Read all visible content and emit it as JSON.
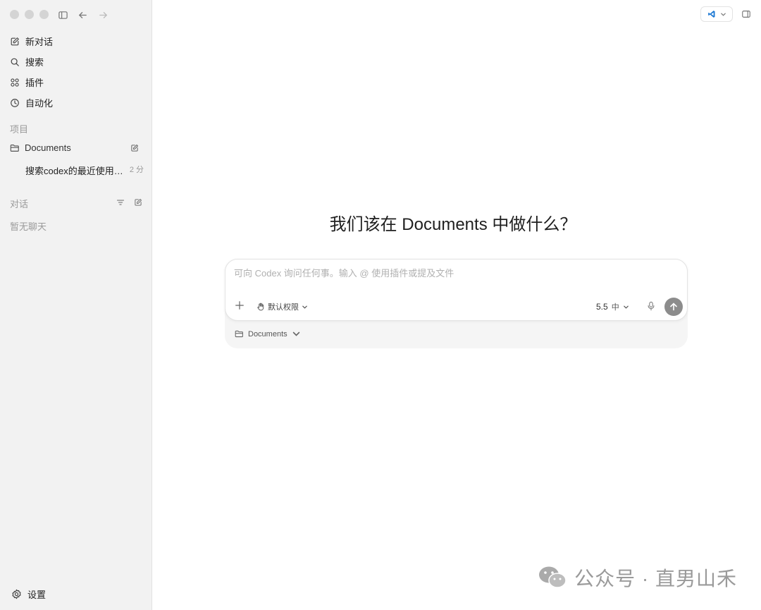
{
  "sidebar": {
    "nav": [
      {
        "label": "新对话",
        "icon": "edit-icon"
      },
      {
        "label": "搜索",
        "icon": "search-icon"
      },
      {
        "label": "插件",
        "icon": "plugins-icon"
      },
      {
        "label": "自动化",
        "icon": "clock-icon"
      }
    ],
    "projects_label": "项目",
    "project_name": "Documents",
    "thread_title": "搜索codex的最近使用…",
    "thread_time": "2 分",
    "chats_label": "对话",
    "empty_chats": "暂无聊天",
    "settings_label": "设置"
  },
  "main": {
    "heading": "我们该在 Documents 中做什么？",
    "composer": {
      "placeholder": "可向 Codex 询问任何事。输入 @ 使用插件或提及文件",
      "permission_label": "默认权限",
      "model_version": "5.5",
      "effort": "中",
      "folder": "Documents"
    }
  },
  "watermark": "公众号 · 直男山禾",
  "colors": {
    "sidebar_bg": "#f2f2f2",
    "send_button": "#8c8c8c",
    "vscode_blue": "#1f7ad4"
  }
}
